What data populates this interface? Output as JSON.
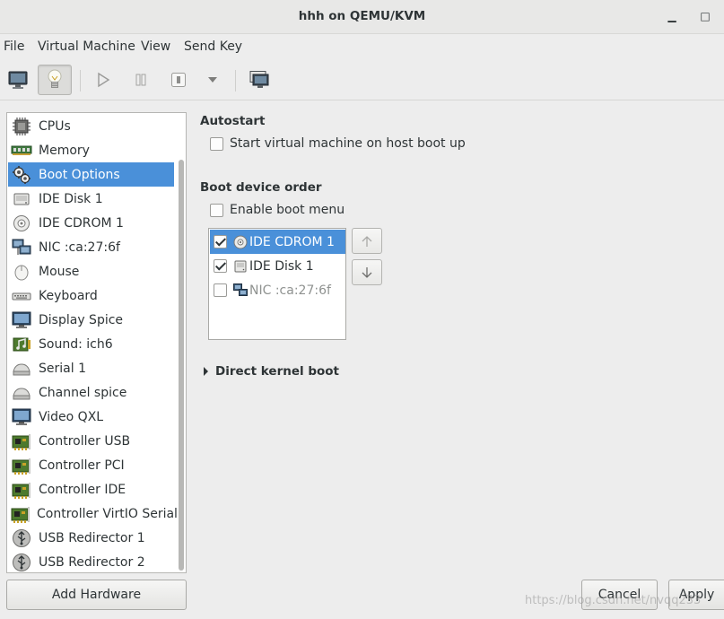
{
  "window": {
    "title": "hhh on QEMU/KVM",
    "minimize_glyph": "▁",
    "maximize_glyph": "□"
  },
  "menu": [
    "File",
    "Virtual Machine",
    "View",
    "Send Key"
  ],
  "toolbar": {
    "icons": [
      "console-monitor-icon",
      "details-lightbulb-icon",
      "run-icon",
      "pause-icon",
      "power-icon",
      "dropdown-arrow-icon",
      "fullscreen-screenshot-icon"
    ],
    "active": "details-lightbulb-icon"
  },
  "sidebar": {
    "items": [
      {
        "label": "CPUs",
        "icon": "cpu-icon"
      },
      {
        "label": "Memory",
        "icon": "memory-icon"
      },
      {
        "label": "Boot Options",
        "icon": "gears-icon",
        "selected": true
      },
      {
        "label": "IDE Disk 1",
        "icon": "disk-icon"
      },
      {
        "label": "IDE CDROM 1",
        "icon": "cdrom-icon"
      },
      {
        "label": "NIC :ca:27:6f",
        "icon": "network-icon"
      },
      {
        "label": "Mouse",
        "icon": "mouse-icon"
      },
      {
        "label": "Keyboard",
        "icon": "keyboard-icon"
      },
      {
        "label": "Display Spice",
        "icon": "display-icon"
      },
      {
        "label": "Sound: ich6",
        "icon": "sound-icon"
      },
      {
        "label": "Serial 1",
        "icon": "serial-icon"
      },
      {
        "label": "Channel spice",
        "icon": "channel-icon"
      },
      {
        "label": "Video QXL",
        "icon": "video-icon"
      },
      {
        "label": "Controller USB",
        "icon": "controller-icon"
      },
      {
        "label": "Controller PCI",
        "icon": "controller-icon"
      },
      {
        "label": "Controller IDE",
        "icon": "controller-icon"
      },
      {
        "label": "Controller VirtIO Serial",
        "icon": "controller-icon"
      },
      {
        "label": "USB Redirector 1",
        "icon": "usb-icon"
      },
      {
        "label": "USB Redirector 2",
        "icon": "usb-icon"
      }
    ],
    "add_hardware_label": "Add Hardware"
  },
  "autostart": {
    "title": "Autostart",
    "checkbox_label": "Start virtual machine on host boot up",
    "checked": false
  },
  "boot_order": {
    "title": "Boot device order",
    "enable_menu_label": "Enable boot menu",
    "enable_menu_checked": false,
    "devices": [
      {
        "label": "IDE CDROM 1",
        "checked": true,
        "selected": true,
        "icon": "cdrom-icon"
      },
      {
        "label": "IDE Disk 1",
        "checked": true,
        "selected": false,
        "icon": "disk-icon"
      },
      {
        "label": "NIC :ca:27:6f",
        "checked": false,
        "selected": false,
        "disabled": true,
        "icon": "network-icon"
      }
    ]
  },
  "direct_kernel_boot": {
    "label": "Direct kernel boot",
    "expanded": false
  },
  "buttons": {
    "cancel": "Cancel",
    "apply": "Apply"
  },
  "watermark": "https://blog.csdn.net/nvqq233"
}
